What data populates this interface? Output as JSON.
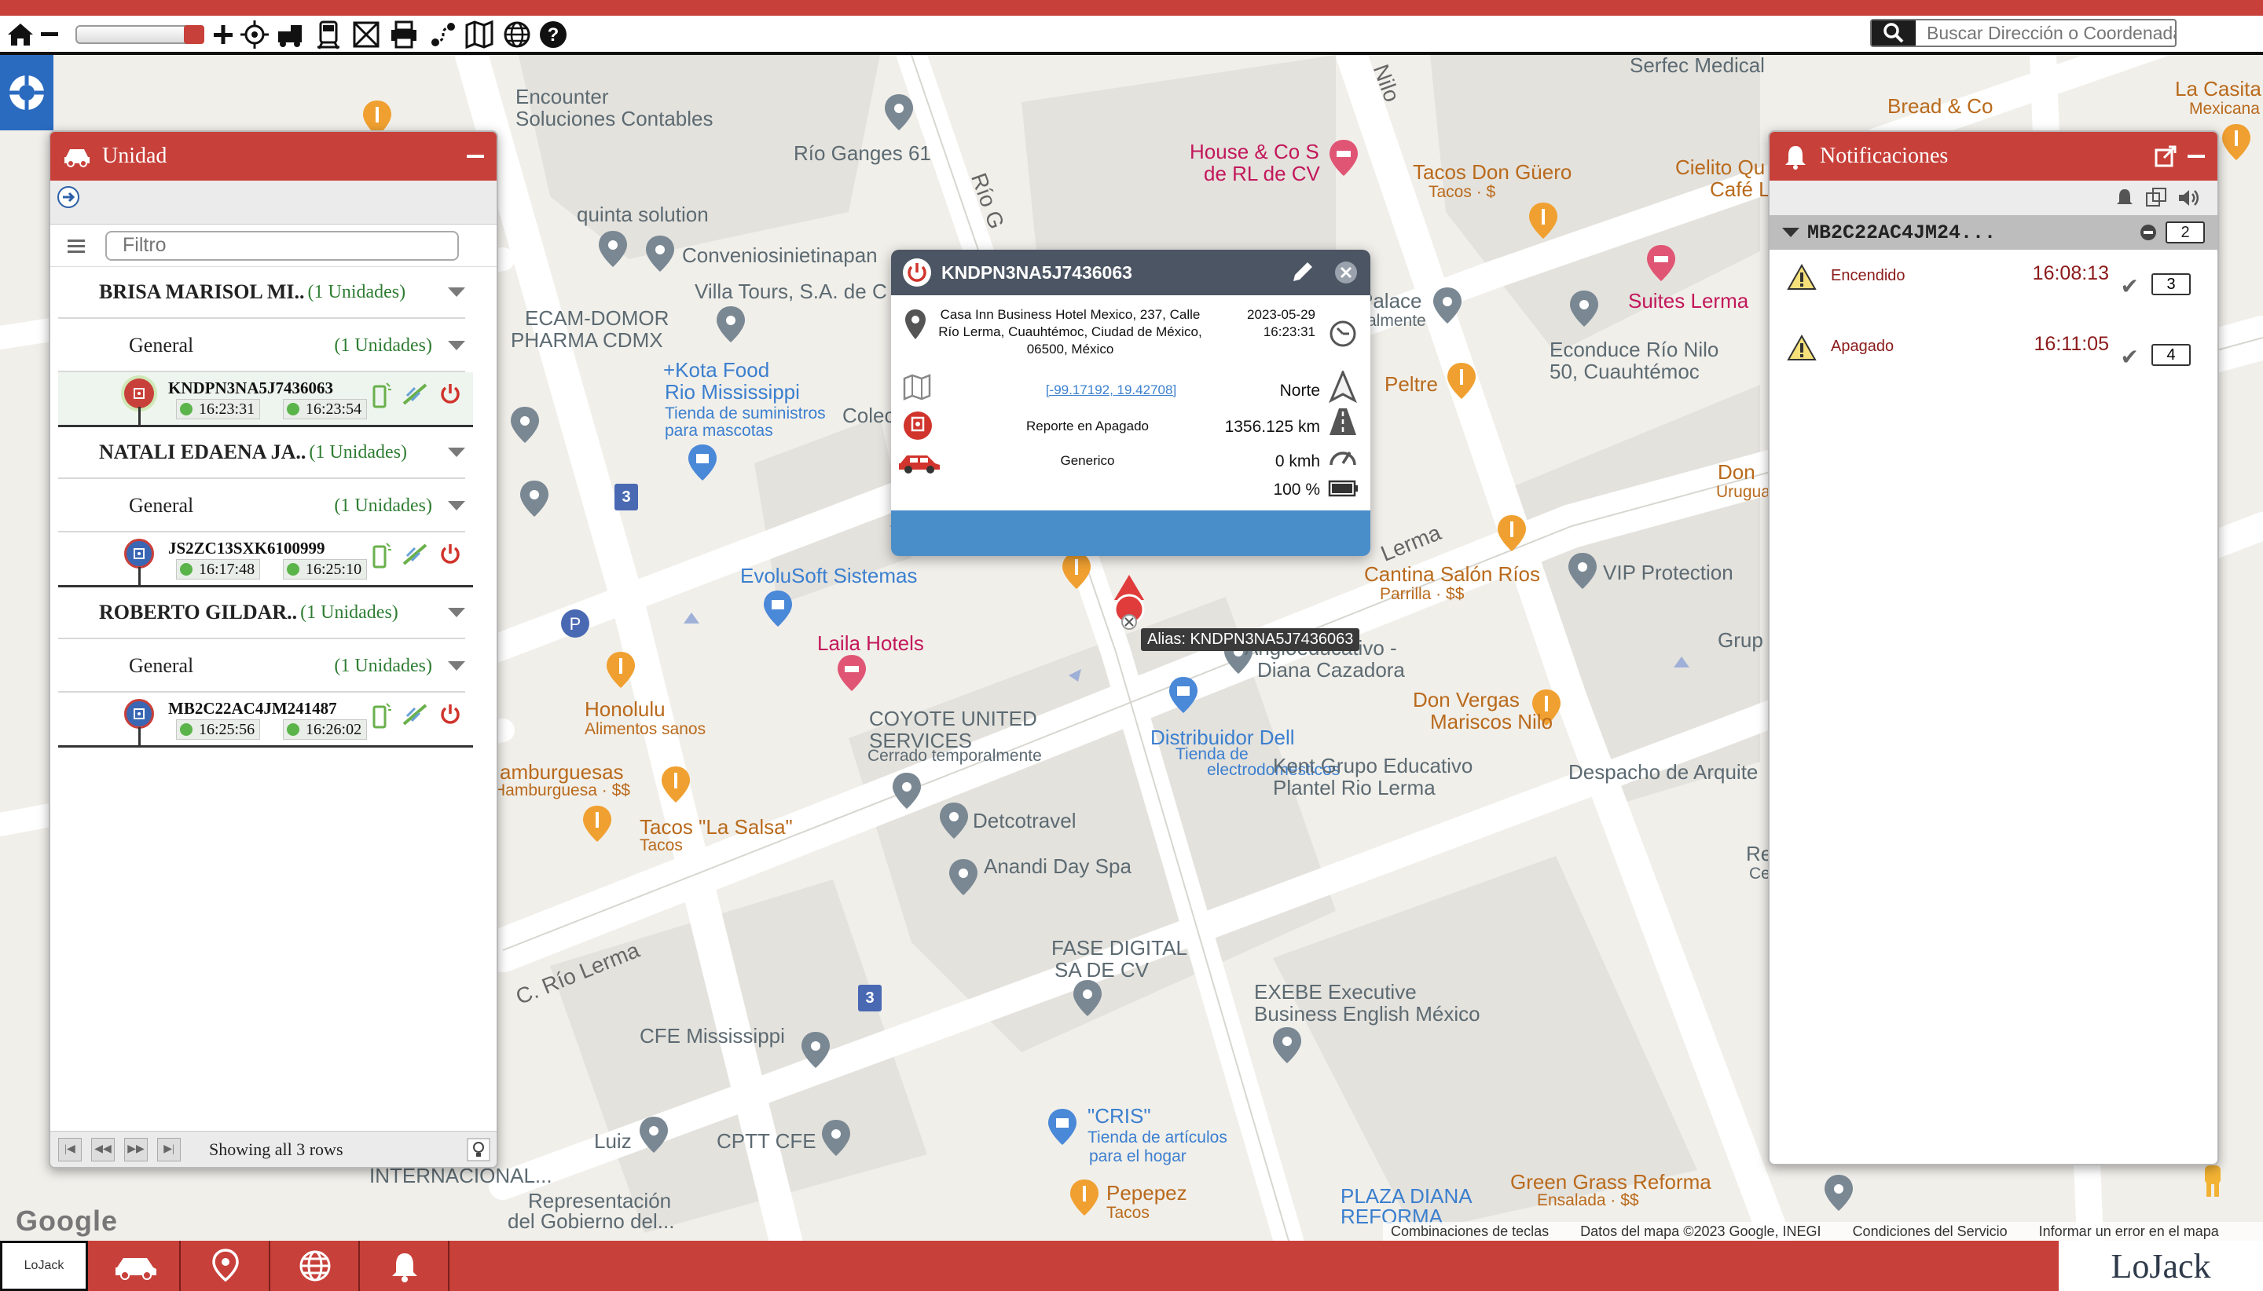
{
  "toolbar": {
    "search_placeholder": "Buscar Dirección o Coordenada",
    "zoom_level": 0.9,
    "icons": [
      "home-icon",
      "zoom-out-icon",
      "zoom-in-icon",
      "gps-icon",
      "vehicle-icon",
      "train-icon",
      "map-tools-icon",
      "print-icon",
      "route-icon",
      "map-icon",
      "globe-icon",
      "help-icon"
    ]
  },
  "unidad_panel": {
    "title": "Unidad",
    "filter_placeholder": "Filtro",
    "footer": "Showing all 3 rows",
    "groups": [
      {
        "name": "BRISA MARISOL MI..",
        "count": "(1 Unidades)",
        "sub": {
          "name": "General",
          "count": "(1 Unidades)"
        },
        "unit": {
          "id": "KNDPN3NA5J7436063",
          "t1": "16:23:31",
          "t2": "16:23:54",
          "icon_color": "#c8403a"
        }
      },
      {
        "name": "NATALI EDAENA JA..",
        "count": "(1 Unidades)",
        "sub": {
          "name": "General",
          "count": "(1 Unidades)"
        },
        "unit": {
          "id": "JS2ZC13SXK6100999",
          "t1": "16:17:48",
          "t2": "16:25:10",
          "icon_color": "#3a67b4"
        }
      },
      {
        "name": "ROBERTO GILDAR..",
        "count": "(1 Unidades)",
        "sub": {
          "name": "General",
          "count": "(1 Unidades)"
        },
        "unit": {
          "id": "MB2C22AC4JM241487",
          "t1": "16:25:56",
          "t2": "16:26:02",
          "icon_color": "#3a67b4"
        }
      }
    ]
  },
  "notif_panel": {
    "title": "Notificaciones",
    "device": "MB2C22AC4JM24...",
    "device_count": "2",
    "items": [
      {
        "label": "Encendido",
        "time": "16:08:13",
        "count": "3"
      },
      {
        "label": "Apagado",
        "time": "16:11:05",
        "count": "4"
      }
    ]
  },
  "popup": {
    "title": "KNDPN3NA5J7436063",
    "address": "Casa Inn Business Hotel Mexico, 237, Calle Río Lerma, Cuauhtémoc, Ciudad de México, 06500, México",
    "date": "2023-05-29",
    "time": "16:23:31",
    "coords": "[-99.17192, 19.42708]",
    "direction": "Norte",
    "report": "Reporte en Apagado",
    "odometer": "1356.125 km",
    "vehicle_type": "Generico",
    "speed": "0 kmh",
    "battery": "100 %"
  },
  "alias": "Alias: KNDPN3NA5J7436063",
  "map": {
    "labels": [
      {
        "t": "Serfec Medical",
        "c": ""
      },
      {
        "t": "Encounter",
        "c": ""
      },
      {
        "t": "Soluciones Contables",
        "c": ""
      },
      {
        "t": "Río Ganges 61",
        "c": ""
      },
      {
        "t": "House & Co S",
        "c": "ml-pink"
      },
      {
        "t": "de RL de CV",
        "c": "ml-pink"
      },
      {
        "t": "Tacos Don Güero",
        "c": "ml-orange"
      },
      {
        "t": "Tacos · $",
        "c": "ml-orange ml-small"
      },
      {
        "t": "Cielito Qu",
        "c": "ml-orange"
      },
      {
        "t": "Café L",
        "c": "ml-orange"
      },
      {
        "t": "Bread & Co",
        "c": "ml-orange"
      },
      {
        "t": "La Casita",
        "c": "ml-orange"
      },
      {
        "t": "Mexicana",
        "c": "ml-orange ml-small"
      },
      {
        "t": "quinta solution",
        "c": ""
      },
      {
        "t": "Conveniosinietinapan",
        "c": ""
      },
      {
        "t": "Villa Tours, S.A. de C",
        "c": ""
      },
      {
        "t": "ECAM-DOMOR",
        "c": ""
      },
      {
        "t": "PHARMA CDMX",
        "c": ""
      },
      {
        "t": "+Kota Food",
        "c": "ml-blue"
      },
      {
        "t": "Rio Mississippi",
        "c": "ml-blue"
      },
      {
        "t": "Tienda de suministros",
        "c": "ml-blue ml-small"
      },
      {
        "t": "para mascotas",
        "c": "ml-blue ml-small"
      },
      {
        "t": "Colec",
        "c": ""
      },
      {
        "t": "Palace",
        "c": ""
      },
      {
        "t": "almente",
        "c": "ml-small"
      },
      {
        "t": "Suites Lerma",
        "c": "ml-pink"
      },
      {
        "t": "Econduce Río Nilo",
        "c": ""
      },
      {
        "t": "50, Cuauhtémoc",
        "c": ""
      },
      {
        "t": "Peltre",
        "c": "ml-orange"
      },
      {
        "t": "Don",
        "c": "ml-orange"
      },
      {
        "t": "Urugua",
        "c": "ml-orange ml-small"
      },
      {
        "t": "EvoluSoft Sistemas",
        "c": "ml-blue"
      },
      {
        "t": "Cantina Salón Ríos",
        "c": "ml-orange"
      },
      {
        "t": "Parrilla · $$",
        "c": "ml-orange ml-small"
      },
      {
        "t": "VIP Protection",
        "c": ""
      },
      {
        "t": "Grup",
        "c": ""
      },
      {
        "t": "Laila Hotels",
        "c": "ml-pink"
      },
      {
        "t": "Angloeducativo -",
        "c": ""
      },
      {
        "t": "Diana Cazadora",
        "c": ""
      },
      {
        "t": "Don Vergas",
        "c": "ml-orange"
      },
      {
        "t": "Mariscos Nilo",
        "c": "ml-orange"
      },
      {
        "t": "Honolulu",
        "c": "ml-orange"
      },
      {
        "t": "Alimentos sanos",
        "c": "ml-orange ml-small"
      },
      {
        "t": "COYOTE UNITED",
        "c": ""
      },
      {
        "t": "SERVICES",
        "c": ""
      },
      {
        "t": "Cerrado temporalmente",
        "c": "ml-small"
      },
      {
        "t": "Distribuidor Dell",
        "c": "ml-blue"
      },
      {
        "t": "Tienda de",
        "c": "ml-blue ml-small"
      },
      {
        "t": "electrodomésticos",
        "c": "ml-blue ml-small"
      },
      {
        "t": "Kent Grupo Educativo",
        "c": ""
      },
      {
        "t": "Plantel Rio Lerma",
        "c": ""
      },
      {
        "t": "Despacho de Arquite",
        "c": ""
      },
      {
        "t": "amburguesas",
        "c": "ml-orange"
      },
      {
        "t": "Hamburguesa · $$",
        "c": "ml-orange ml-small"
      },
      {
        "t": "Tacos \"La Salsa\"",
        "c": "ml-orange"
      },
      {
        "t": "Tacos",
        "c": "ml-orange ml-small"
      },
      {
        "t": "Detcotravel",
        "c": ""
      },
      {
        "t": "Anandi Day Spa",
        "c": ""
      },
      {
        "t": "Restau",
        "c": ""
      },
      {
        "t": "Cerrado",
        "c": "ml-small"
      },
      {
        "t": "FASE DIGITAL",
        "c": ""
      },
      {
        "t": "SA DE CV",
        "c": ""
      },
      {
        "t": "EXEBE Executive",
        "c": ""
      },
      {
        "t": "Business English México",
        "c": ""
      },
      {
        "t": "CFE Mississippi",
        "c": ""
      },
      {
        "t": "Luiz",
        "c": ""
      },
      {
        "t": "CPTT CFE",
        "c": ""
      },
      {
        "t": "\"CRIS\"",
        "c": "ml-blue"
      },
      {
        "t": "Tienda de artículos",
        "c": "ml-blue ml-small"
      },
      {
        "t": "para el hogar",
        "c": "ml-blue ml-small"
      },
      {
        "t": "Green Grass Reforma",
        "c": "ml-orange"
      },
      {
        "t": "Ensalada · $$",
        "c": "ml-orange ml-small"
      },
      {
        "t": "INTERNACIONAL...",
        "c": ""
      },
      {
        "t": "Representación",
        "c": ""
      },
      {
        "t": "del Gobierno del...",
        "c": ""
      },
      {
        "t": "Pepepez",
        "c": "ml-orange"
      },
      {
        "t": "Tacos",
        "c": "ml-orange ml-small"
      },
      {
        "t": "PLAZA DIANA",
        "c": "ml-blue"
      },
      {
        "t": "REFORMA",
        "c": "ml-blue"
      }
    ],
    "streets": [
      {
        "t": "C. Río Lerma"
      },
      {
        "t": "Lerma"
      },
      {
        "t": "Río G"
      },
      {
        "t": "Nilo"
      }
    ],
    "footer": [
      "Combinaciones de teclas",
      "Datos del mapa ©2023 Google, INEGI",
      "Condiciones del Servicio",
      "Informar un error en el mapa"
    ],
    "google": "Google"
  },
  "bottom": {
    "logo_left": "LoJack",
    "brand": "LoJack"
  }
}
